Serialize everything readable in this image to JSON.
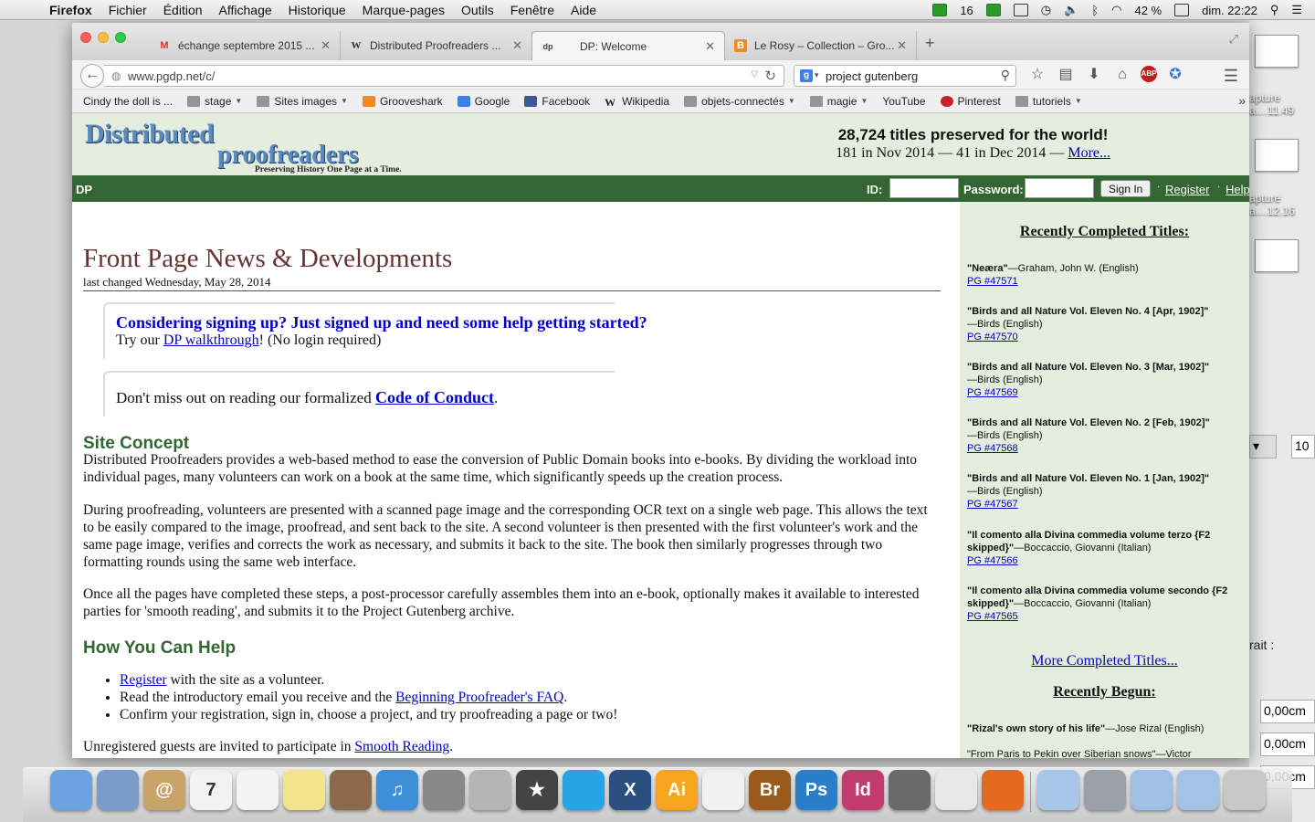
{
  "menubar": {
    "apple": "",
    "app_name": "Firefox",
    "menus": [
      "Fichier",
      "Édition",
      "Affichage",
      "Historique",
      "Marque-pages",
      "Outils",
      "Fenêtre",
      "Aide"
    ],
    "status_count": "16",
    "battery": "42 %",
    "clock": "dim. 22:22"
  },
  "desktop": {
    "label1": "apture",
    "label1b": "a....11.49",
    "label2": "apture",
    "label2b": "a....12.16",
    "field_value": "10",
    "label_trait": "rait :",
    "field1": "0,00cm",
    "field2": "0,00cm",
    "field3": "0,00cm"
  },
  "tabs": [
    {
      "icon": "gmail-icon",
      "fav": "M",
      "title": "échange septembre 2015 ..."
    },
    {
      "icon": "wikipedia-icon",
      "fav": "W",
      "title": "Distributed Proofreaders ..."
    },
    {
      "icon": "dp-icon",
      "fav": "dp",
      "title": "DP: Welcome"
    },
    {
      "icon": "blogger-icon",
      "fav": "B",
      "title": "Le Rosy – Collection – Gro..."
    }
  ],
  "navbar": {
    "url": "www.pgdp.net/c/",
    "search_value": "project gutenberg"
  },
  "bookmarks": [
    {
      "label": "Cindy the doll is ...",
      "kind": "page",
      "menu": false
    },
    {
      "label": "stage",
      "kind": "folder",
      "menu": true
    },
    {
      "label": "Sites images",
      "kind": "folder",
      "menu": true
    },
    {
      "label": "Grooveshark",
      "kind": "orange",
      "menu": false
    },
    {
      "label": "Google",
      "kind": "gblue",
      "menu": false
    },
    {
      "label": "Facebook",
      "kind": "fbblue",
      "menu": false
    },
    {
      "label": "Wikipedia",
      "kind": "wiki",
      "menu": false
    },
    {
      "label": "objets-connectés",
      "kind": "folder",
      "menu": true
    },
    {
      "label": "magie",
      "kind": "folder",
      "menu": true
    },
    {
      "label": "YouTube",
      "kind": "page",
      "menu": false
    },
    {
      "label": "Pinterest",
      "kind": "pin",
      "menu": false
    },
    {
      "label": "tutoriels",
      "kind": "folder",
      "menu": true
    }
  ],
  "header": {
    "logo_line1": "Distributed",
    "logo_line2": "proofreaders",
    "logo_tagline": "Preserving History One Page at a Time.",
    "titles_preserved": "28,724 titles preserved for the world!",
    "monthly_prefix": "181 in Nov 2014 — 41 in Dec 2014 — ",
    "more_link": "More..."
  },
  "loginbar": {
    "site_label": "DP",
    "id_label": "ID:",
    "password_label": "Password:",
    "signin_button": "Sign In",
    "register_link": "Register",
    "help_link": "Help"
  },
  "main": {
    "news_title": "Front Page News & Developments",
    "last_changed": "last changed Wednesday, May 28, 2014",
    "box1_question": "Considering signing up? Just signed up and need some help getting started?",
    "box1_prefix": "Try our ",
    "box1_link": "DP walkthrough",
    "box1_suffix": "! (No login required)",
    "box2_prefix": "Don't miss out on reading our formalized ",
    "box2_link": "Code of Conduct",
    "box2_suffix": ".",
    "concept_heading": "Site Concept",
    "concept_p1": "Distributed Proofreaders provides a web-based method to ease the conversion of Public Domain books into e-books. By dividing the workload into individual pages, many volunteers can work on a book at the same time, which significantly speeds up the creation process.",
    "concept_p2": "During proofreading, volunteers are presented with a scanned page image and the corresponding OCR text on a single web page. This allows the text to be easily compared to the image, proofread, and sent back to the site. A second volunteer is then presented with the first volunteer's work and the same page image, verifies and corrects the work as necessary, and submits it back to the site. The book then similarly progresses through two formatting rounds using the same web interface.",
    "concept_p3": "Once all the pages have completed these steps, a post-processor carefully assembles them into an e-book, optionally makes it available to interested parties for 'smooth reading', and submits it to the Project Gutenberg archive.",
    "help_heading": "How You Can Help",
    "help_li1_link": "Register",
    "help_li1_rest": " with the site as a volunteer.",
    "help_li2_prefix": "Read the introductory email you receive and the ",
    "help_li2_link": "Beginning Proofreader's FAQ",
    "help_li2_suffix": ".",
    "help_li3": "Confirm your registration, sign in, choose a project, and try proofreading a page or two!",
    "unreg_prefix": "Unregistered guests are invited to participate in ",
    "unreg_link": "Smooth Reading",
    "unreg_suffix": "."
  },
  "sidebar": {
    "completed_heading": "Recently Completed Titles:",
    "completed": [
      {
        "title": "\"Neæra\"",
        "line1_rest": "—Graham, John W. (English)",
        "line2": "",
        "pg": "PG #47571"
      },
      {
        "title": "\"Birds and all Nature Vol. Eleven No. 4 [Apr, 1902]\"",
        "line1_rest": "",
        "line2": "—Birds (English)",
        "pg": "PG #47570"
      },
      {
        "title": "\"Birds and all Nature Vol. Eleven No. 3 [Mar, 1902]\"",
        "line1_rest": "",
        "line2": "—Birds (English)",
        "pg": "PG #47569"
      },
      {
        "title": "\"Birds and all Nature Vol. Eleven No. 2 [Feb, 1902]\"",
        "line1_rest": "",
        "line2": "—Birds (English)",
        "pg": "PG #47568"
      },
      {
        "title": "\"Birds and all Nature Vol. Eleven No. 1 [Jan, 1902]\"",
        "line1_rest": "",
        "line2": "—Birds (English)",
        "pg": "PG #47567"
      },
      {
        "title": "\"Il comento alla Divina commedia volume terzo {F2 skipped}\"",
        "line1_rest": "—Boccaccio, Giovanni (Italian)",
        "line2": "",
        "pg": "PG #47566"
      },
      {
        "title": "\"Il comento alla Divina commedia volume secondo {F2 skipped}\"",
        "line1_rest": "—Boccaccio, Giovanni (Italian)",
        "line2": "",
        "pg": "PG #47565"
      }
    ],
    "more_completed": "More Completed Titles...",
    "begun_heading": "Recently Begun:",
    "begun_item_title": "\"Rizal's own story of his life\"",
    "begun_item_rest": "—Jose Rizal (English)",
    "begun_item2": "\"From Paris to Pekin over Siberian snows\"—Victor"
  },
  "dock": {
    "apps": [
      {
        "name": "finder-icon",
        "label": "",
        "color": "#6aa3e0"
      },
      {
        "name": "mail-icon",
        "label": "",
        "color": "#7a9ccc"
      },
      {
        "name": "contacts-icon",
        "label": "@",
        "color": "#c9a46a"
      },
      {
        "name": "calendar-icon",
        "label": "7",
        "color": "#f2f2f2"
      },
      {
        "name": "reminders-icon",
        "label": "",
        "color": "#f4f4f4"
      },
      {
        "name": "notes-icon",
        "label": "",
        "color": "#f3e38a"
      },
      {
        "name": "iphoto-icon",
        "label": "",
        "color": "#8a6a4a"
      },
      {
        "name": "itunes-icon",
        "label": "♫",
        "color": "#3d8fd8"
      },
      {
        "name": "system-preferences-icon",
        "label": "",
        "color": "#888888"
      },
      {
        "name": "script-editor-icon",
        "label": "",
        "color": "#b5b5b5"
      },
      {
        "name": "imovie-icon",
        "label": "★",
        "color": "#444444"
      },
      {
        "name": "skype-icon",
        "label": "",
        "color": "#2aa3e3"
      },
      {
        "name": "x11-icon",
        "label": "X",
        "color": "#2b4f80"
      },
      {
        "name": "illustrator-icon",
        "label": "Ai",
        "color": "#f7a51e"
      },
      {
        "name": "textedit-icon",
        "label": "",
        "color": "#f1f1f1"
      },
      {
        "name": "bridge-icon",
        "label": "Br",
        "color": "#9c5a1a"
      },
      {
        "name": "photoshop-icon",
        "label": "Ps",
        "color": "#2a7dc8"
      },
      {
        "name": "indesign-icon",
        "label": "Id",
        "color": "#c33b6e"
      },
      {
        "name": "screenshot-icon",
        "label": "",
        "color": "#6a6a6a"
      },
      {
        "name": "preview-icon",
        "label": "",
        "color": "#e8e8e8"
      },
      {
        "name": "firefox-icon",
        "label": "",
        "color": "#e66a1e"
      },
      {
        "name": "documents-folder-icon",
        "label": "",
        "color": "#a8c6e8"
      },
      {
        "name": "drive-icon",
        "label": "",
        "color": "#9aa0a8"
      },
      {
        "name": "applications-folder-icon",
        "label": "",
        "color": "#9fc0e6"
      },
      {
        "name": "downloads-folder-icon",
        "label": "",
        "color": "#a3c3e6"
      },
      {
        "name": "trash-icon",
        "label": "",
        "color": "#c8c8c8"
      }
    ]
  }
}
